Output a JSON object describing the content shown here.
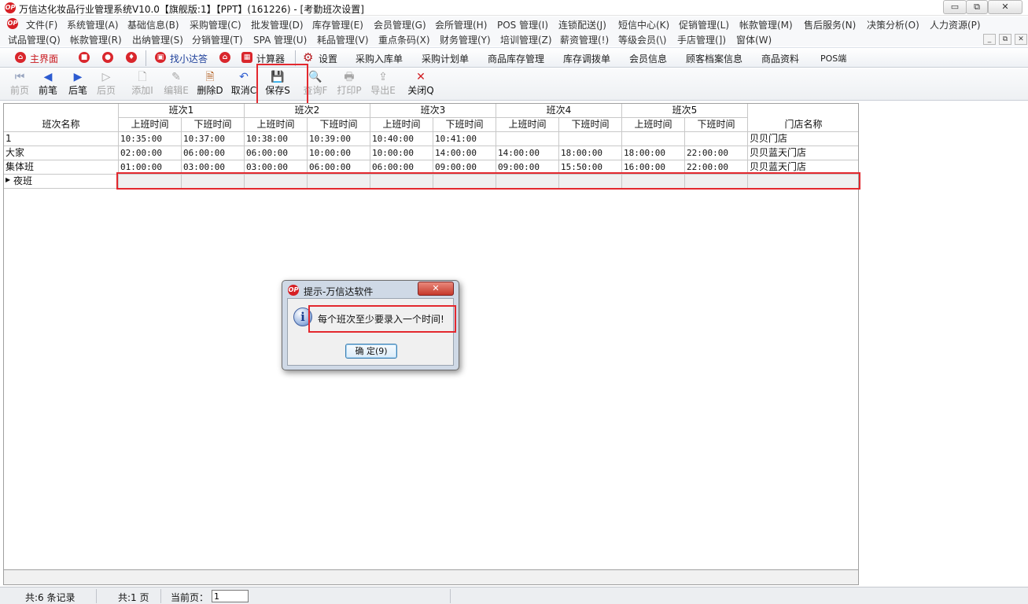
{
  "window": {
    "title": "万信达化妆品行业管理系统V10.0【旗舰版:1】【PPT】(161226) - [考勤班次设置]",
    "logo_text": "OP"
  },
  "menu_row1": [
    "文件(F)",
    "系统管理(A)",
    "基础信息(B)",
    "采购管理(C)",
    "批发管理(D)",
    "库存管理(E)",
    "会员管理(G)",
    "会所管理(H)",
    "POS 管理(I)",
    "连锁配送(J)",
    "短信中心(K)",
    "促销管理(L)",
    "帐款管理(M)",
    "售后服务(N)",
    "决策分析(O)",
    "人力资源(P)"
  ],
  "menu_row2": [
    "试品管理(Q)",
    "帐款管理(R)",
    "出纳管理(S)",
    "分销管理(T)",
    "SPA 管理(U)",
    "耗品管理(V)",
    "重点条码(X)",
    "财务管理(Y)",
    "培训管理(Z)",
    "薪资管理(!)",
    "等级会员(\\)",
    "手店管理(])",
    "窗体(W)"
  ],
  "quickbar": {
    "main": "主界面",
    "find": "找小达答",
    "calc": "计算器",
    "settings": "设置",
    "links": [
      "采购入库单",
      "采购计划单",
      "商品库存管理",
      "库存调拨单",
      "会员信息",
      "顾客档案信息",
      "商品资料",
      "POS端"
    ]
  },
  "toolbar": [
    {
      "label": "前页",
      "icon": "first-page-icon",
      "glyph": "⏮",
      "enabled": false
    },
    {
      "label": "前笔",
      "icon": "prev-record-icon",
      "glyph": "◀",
      "enabled": true
    },
    {
      "label": "后笔",
      "icon": "next-record-icon",
      "glyph": "▶",
      "enabled": true
    },
    {
      "label": "后页",
      "icon": "last-page-icon",
      "glyph": "▷",
      "enabled": false
    },
    {
      "label": "添加I",
      "icon": "add-icon",
      "glyph": "🗋",
      "enabled": false
    },
    {
      "label": "编辑E",
      "icon": "edit-icon",
      "glyph": "✎",
      "enabled": false
    },
    {
      "label": "删除D",
      "icon": "delete-icon",
      "glyph": "🗎",
      "enabled": true
    },
    {
      "label": "取消C",
      "icon": "undo-icon",
      "glyph": "↶",
      "enabled": true
    },
    {
      "label": "保存S",
      "icon": "save-icon",
      "glyph": "💾",
      "enabled": true
    },
    {
      "label": "查询F",
      "icon": "query-icon",
      "glyph": "🔍",
      "enabled": false
    },
    {
      "label": "打印P",
      "icon": "print-icon",
      "glyph": "🖶",
      "enabled": false
    },
    {
      "label": "导出E",
      "icon": "export-icon",
      "glyph": "⇪",
      "enabled": false
    },
    {
      "label": "关闭Q",
      "icon": "close-icon",
      "glyph": "✕",
      "enabled": true
    }
  ],
  "grid": {
    "group_headers": [
      "班次1",
      "班次2",
      "班次3",
      "班次4",
      "班次5"
    ],
    "name_header": "班次名称",
    "start_header": "上班时间",
    "end_header": "下班时间",
    "store_header": "门店名称",
    "rows": [
      {
        "name": "1",
        "times": [
          "10:35:00",
          "10:37:00",
          "10:38:00",
          "10:39:00",
          "10:40:00",
          "10:41:00",
          "",
          "",
          "",
          ""
        ],
        "store": "贝贝门店"
      },
      {
        "name": "大家",
        "times": [
          "02:00:00",
          "06:00:00",
          "06:00:00",
          "10:00:00",
          "10:00:00",
          "14:00:00",
          "14:00:00",
          "18:00:00",
          "18:00:00",
          "22:00:00"
        ],
        "store": "贝贝蓝天门店"
      },
      {
        "name": "集体班",
        "times": [
          "01:00:00",
          "03:00:00",
          "03:00:00",
          "06:00:00",
          "06:00:00",
          "09:00:00",
          "09:00:00",
          "15:50:00",
          "16:00:00",
          "22:00:00"
        ],
        "store": "贝贝蓝天门店"
      },
      {
        "name": "夜班",
        "times": [
          "",
          "",
          "",
          "",
          "",
          "",
          "",
          "",
          "",
          ""
        ],
        "store": ""
      }
    ]
  },
  "status": {
    "records": "共:6 条记录",
    "pages": "共:1 页",
    "current_page_label": "当前页：",
    "current_page_value": "1"
  },
  "dialog": {
    "title": "提示-万信达软件",
    "message": "每个班次至少要录入一个时间!",
    "ok": "确 定(9)",
    "close_glyph": "✕",
    "info_glyph": "i"
  },
  "colors": {
    "highlight": "#e3282e",
    "accent": "#d71f24"
  }
}
